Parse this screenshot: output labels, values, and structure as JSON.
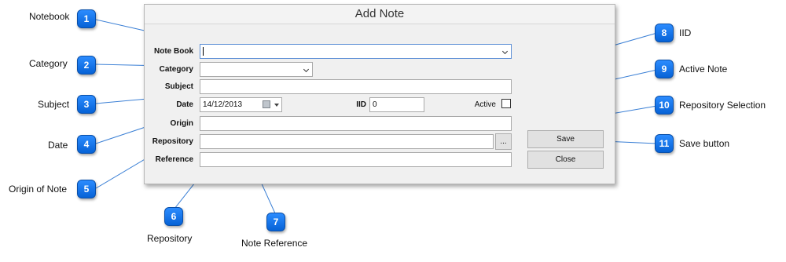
{
  "window": {
    "title": "Add Note",
    "labels": {
      "notebook": "Note Book",
      "category": "Category",
      "subject": "Subject",
      "date": "Date",
      "iid": "IID",
      "active": "Active",
      "origin": "Origin",
      "repository": "Repository",
      "reference": "Reference"
    },
    "fields": {
      "notebook_value": "",
      "category_value": "",
      "subject_value": "",
      "date_value": "14/12/2013",
      "iid_value": "0",
      "origin_value": "",
      "repository_value": "",
      "reference_value": ""
    },
    "buttons": {
      "browse": "...",
      "save": "Save",
      "close": "Close"
    },
    "active_checked": false
  },
  "callouts": [
    {
      "number": "1",
      "label": "Notebook"
    },
    {
      "number": "2",
      "label": "Category"
    },
    {
      "number": "3",
      "label": "Subject"
    },
    {
      "number": "4",
      "label": "Date"
    },
    {
      "number": "5",
      "label": "Origin of Note"
    },
    {
      "number": "6",
      "label": "Repository"
    },
    {
      "number": "7",
      "label": "Note Reference"
    },
    {
      "number": "8",
      "label": "IID"
    },
    {
      "number": "9",
      "label": "Active Note"
    },
    {
      "number": "10",
      "label": "Repository Selection"
    },
    {
      "number": "11",
      "label": "Save button"
    }
  ],
  "colors": {
    "badge": "#1a7af0",
    "line": "#3a7fd5"
  }
}
